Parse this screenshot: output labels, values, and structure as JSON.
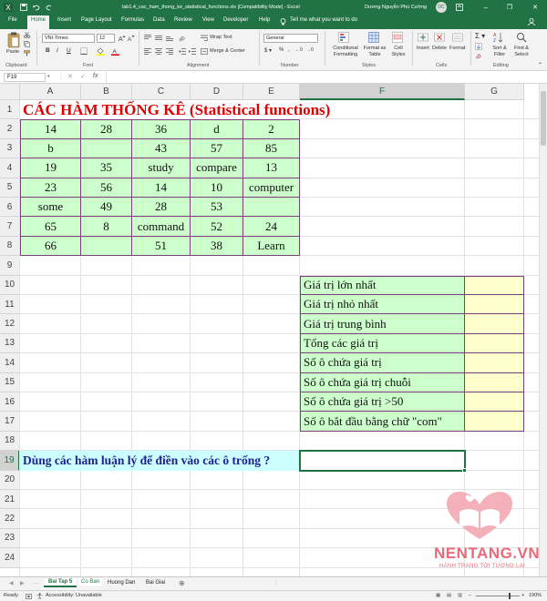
{
  "window": {
    "title": "lab1.4_cac_ham_thong_ke_statistical_functions.xls [Compatibility Mode] - Excel",
    "user": "Dương Nguyễn Phú Cường",
    "user_initials": "DC",
    "minimize": "–",
    "restore": "❐",
    "close": "✕"
  },
  "tabs": [
    "File",
    "Home",
    "Insert",
    "Page Layout",
    "Formulas",
    "Data",
    "Review",
    "View",
    "Developer",
    "Help"
  ],
  "tell_me": "Tell me what you want to do",
  "ribbon": {
    "paste": "Paste",
    "font_name": "VNI-Times",
    "font_size": "12",
    "bold": "B",
    "italic": "I",
    "underline": "U",
    "wrap_text": "Wrap Text",
    "merge_center": "Merge & Center",
    "number_format": "General",
    "conditional_formatting": "Conditional Formatting",
    "format_as_table": "Format as Table",
    "cell_styles": "Cell Styles",
    "insert": "Insert",
    "delete": "Delete",
    "format": "Format",
    "sort_filter": "Sort & Filter",
    "find_select": "Find & Select",
    "groups": [
      "Clipboard",
      "Font",
      "Alignment",
      "Number",
      "Styles",
      "Cells",
      "Editing"
    ]
  },
  "formula_bar": {
    "name_box": "F19",
    "fx": "fx",
    "value": ""
  },
  "columns": [
    "A",
    "B",
    "C",
    "D",
    "E",
    "F",
    "G"
  ],
  "selected_column": "F",
  "rows": [
    "1",
    "2",
    "3",
    "4",
    "5",
    "6",
    "7",
    "8",
    "9",
    "10",
    "11",
    "12",
    "13",
    "14",
    "15",
    "16",
    "17",
    "18",
    "19",
    "20",
    "21",
    "22",
    "23",
    "24"
  ],
  "selected_row": "19",
  "sheet": {
    "title": "CÁC HÀM THỐNG KÊ (Statistical functions)",
    "data": [
      [
        "14",
        "28",
        "36",
        "d",
        "2"
      ],
      [
        "b",
        "",
        "43",
        "57",
        "85"
      ],
      [
        "19",
        "35",
        "study",
        "compare",
        "13"
      ],
      [
        "23",
        "56",
        "14",
        "10",
        "computer"
      ],
      [
        "some",
        "49",
        "28",
        "53",
        ""
      ],
      [
        "65",
        "8",
        "command",
        "52",
        "24"
      ],
      [
        "66",
        "",
        "51",
        "38",
        "Learn"
      ]
    ],
    "labels": [
      "Giá trị lớn nhất",
      "Giá trị nhỏ nhất",
      "Giá trị trung bình",
      "Tổng các giá trị",
      "Số ô chứa giá trị",
      "Số ô chứa giá trị chuỗi",
      "Số ô chứa giá trị >50",
      "Số ô bắt đầu bằng chữ \"com\""
    ],
    "question": "Dùng các hàm luận lý để điền vào các ô trống ?"
  },
  "watermark": {
    "brand": "NENTANG.VN",
    "tagline": "HÀNH TRANG TỚI TƯƠNG LAI"
  },
  "sheet_tabs": [
    "Bai Tap 5",
    "Co Ban",
    "Huong Dan",
    "Bai Giai"
  ],
  "status": {
    "ready": "Ready",
    "accessibility": "Accessibility: Unavailable",
    "zoom": "190%"
  },
  "colors": {
    "excel_green": "#217346",
    "cell_green": "#ccffcc",
    "cell_yellow": "#ffffcc",
    "cell_cyan": "#ccffff",
    "title_red": "#e00000",
    "question_blue": "#1f1f8f",
    "border_purple": "#7b3f7b",
    "watermark_pink": "#e85a6a"
  }
}
